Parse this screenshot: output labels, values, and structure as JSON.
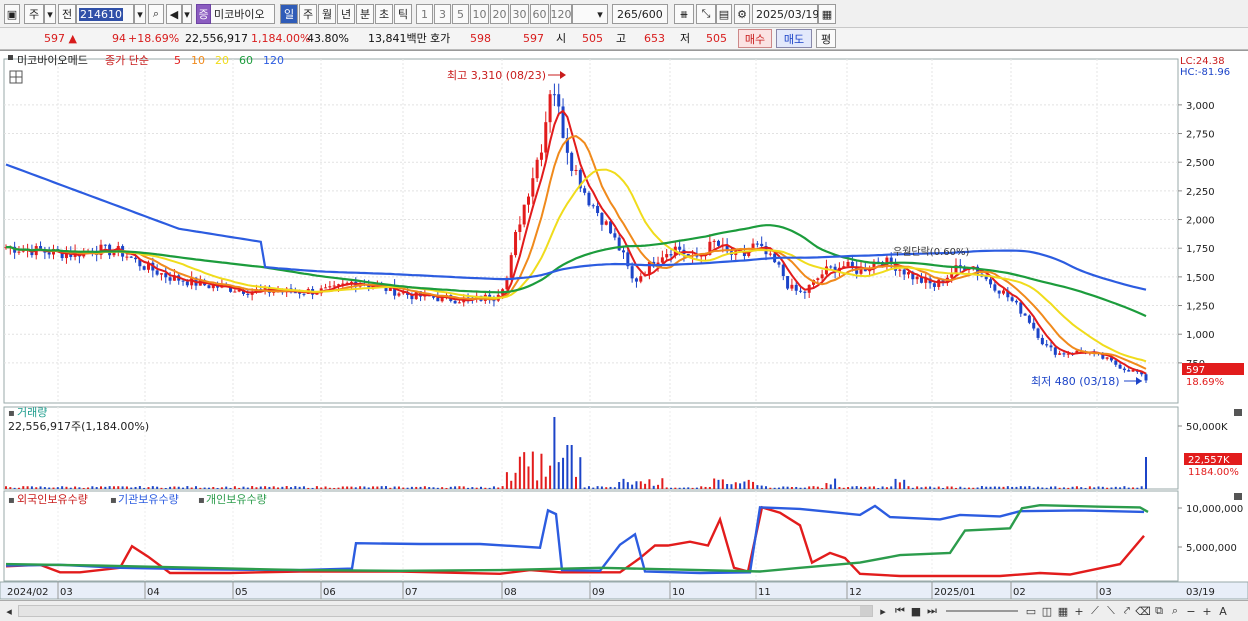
{
  "toolbar": {
    "market_label": "주",
    "all_label": "전",
    "code": "214610",
    "stock_badge": "증",
    "stock_name": "미코바이오",
    "periods": [
      "일",
      "주",
      "월",
      "년",
      "분",
      "초",
      "틱"
    ],
    "active_period": "일",
    "numbers": [
      "1",
      "3",
      "5",
      "10",
      "20",
      "30",
      "60",
      "120"
    ],
    "count": "265",
    "count_total": "/600",
    "date": "2025/03/19"
  },
  "quote": {
    "price": "597",
    "change": "94",
    "change_pct": "+18.69%",
    "volume": "22,556,917",
    "volume_pct": "1,184.00%",
    "turnover": "43.80%",
    "amount": "13,841백만",
    "label_ask": "호가",
    "ask": "598",
    "bid": "597",
    "label_open": "시",
    "open": "505",
    "label_high": "고",
    "high": "653",
    "label_low": "저",
    "low": "505",
    "buy_label": "매수",
    "sell_label": "매도",
    "eval_label": "평"
  },
  "legend": {
    "stock": "미코바이오메드",
    "ma_label": "종가 단순",
    "ma_periods": [
      {
        "label": "5",
        "color": "#e21c1c"
      },
      {
        "label": "10",
        "color": "#f08a1c"
      },
      {
        "label": "20",
        "color": "#f0dc1c"
      },
      {
        "label": "60",
        "color": "#1c9c3c"
      },
      {
        "label": "120",
        "color": "#2c5ce0"
      }
    ],
    "lc": "LC:24.38",
    "hc": "HC:-81.96"
  },
  "annotations": {
    "high": "최고 3,310 (08/23)",
    "low": "최저 480 (03/18)",
    "overlay_text": "우월단락(0.60%)",
    "price_tag": "597",
    "pct_tag": "18.69%"
  },
  "volume_panel": {
    "title": "거래량",
    "value": "22,556,917주(1,184.00%)",
    "axis_top": "50,000K",
    "tag": "22,557K",
    "tag2": "1184.00%"
  },
  "holdings_panel": {
    "foreign": "외국인보유수량",
    "inst": "기관보유수량",
    "indiv": "개인보유수량",
    "axis": [
      "10,000,000",
      "5,000,000"
    ]
  },
  "price_axis": [
    "3,000",
    "2,750",
    "2,500",
    "2,250",
    "2,000",
    "1,750",
    "1,500",
    "1,250",
    "1,000",
    "750"
  ],
  "date_axis": [
    "2024/02",
    "03",
    "04",
    "05",
    "06",
    "07",
    "08",
    "09",
    "10",
    "11",
    "12",
    "2025/01",
    "02",
    "03"
  ],
  "date_end": "03/19",
  "colors": {
    "up": "#e21c1c",
    "down": "#1c44c8",
    "ma5": "#e21c1c",
    "ma10": "#f08a1c",
    "ma20": "#f0dc1c",
    "ma60": "#1c9c3c",
    "ma120": "#2c5ce0",
    "foreign": "#e21c1c",
    "inst": "#2c5ce0",
    "indiv": "#2c9c4c"
  }
}
